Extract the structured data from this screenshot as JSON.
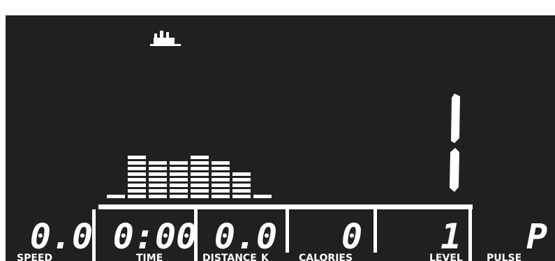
{
  "caption": "",
  "display": {
    "program_profile": {
      "level_heights": [
        1,
        8,
        7,
        7,
        8,
        7,
        5,
        1
      ],
      "icon": "program-person-icon"
    },
    "large_level": "1",
    "fields": [
      {
        "id": "speed",
        "value": "0.0",
        "label": "SPEED"
      },
      {
        "id": "time",
        "value": "0:00",
        "label": "TIME"
      },
      {
        "id": "distance",
        "value": "0.0",
        "label": "DISTANCE",
        "unit": "K"
      },
      {
        "id": "calories",
        "value": "0",
        "label": "CALORIES"
      },
      {
        "id": "level",
        "value": "1",
        "label": "LEVEL"
      },
      {
        "id": "pulse",
        "value": "P",
        "label": "PULSE"
      }
    ],
    "colors": {
      "background": "#202020",
      "segments": "#ffffff"
    }
  }
}
